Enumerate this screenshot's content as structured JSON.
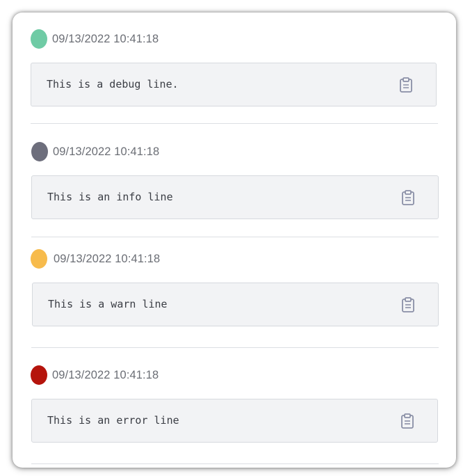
{
  "colors": {
    "debug": "#6fcba5",
    "info": "#6d6e7c",
    "warn": "#f7bb4c",
    "error": "#b5140c",
    "copy_icon": "#8a8fa6"
  },
  "entries": [
    {
      "level": "debug",
      "timestamp": "09/13/2022 10:41:18",
      "message": "This is a debug line.",
      "copy_icon": "clipboard-icon"
    },
    {
      "level": "info",
      "timestamp": "09/13/2022 10:41:18",
      "message": "This is an info line",
      "copy_icon": "clipboard-icon"
    },
    {
      "level": "warn",
      "timestamp": "09/13/2022 10:41:18",
      "message": "This is a warn line",
      "copy_icon": "clipboard-icon"
    },
    {
      "level": "error",
      "timestamp": "09/13/2022 10:41:18",
      "message": "This is an error line",
      "copy_icon": "clipboard-icon"
    }
  ]
}
